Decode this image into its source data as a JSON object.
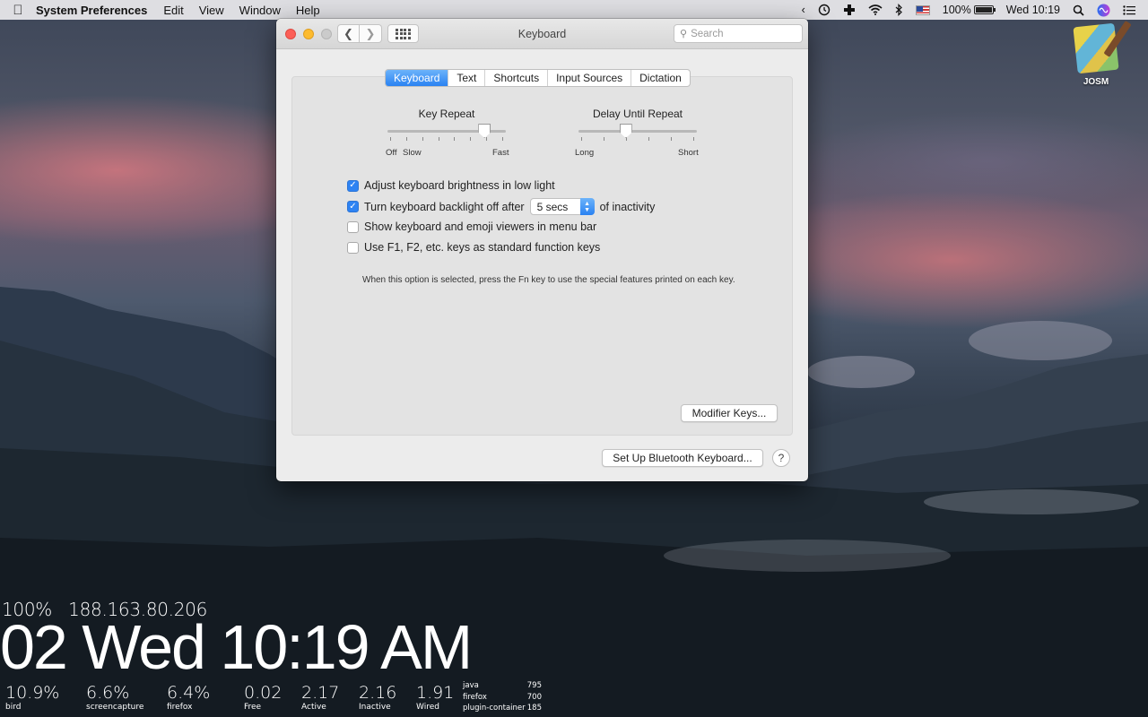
{
  "menubar": {
    "app_name": "System Preferences",
    "menus": [
      "Edit",
      "View",
      "Window",
      "Help"
    ],
    "battery_percent": "100%",
    "battery_level": 1.0,
    "clock": "Wed 10:19",
    "icons": [
      "apple-icon",
      "chevron-left-icon",
      "time-machine-icon",
      "plus-cross-icon",
      "wifi-icon",
      "bluetooth-icon",
      "us-flag-icon",
      "battery-icon",
      "search-icon",
      "siri-icon",
      "notification-center-icon"
    ]
  },
  "desktop": {
    "josm_label": "JOSM"
  },
  "window": {
    "title": "Keyboard",
    "search_placeholder": "Search",
    "tabs": [
      "Keyboard",
      "Text",
      "Shortcuts",
      "Input Sources",
      "Dictation"
    ],
    "active_tab": "Keyboard",
    "key_repeat": {
      "title": "Key Repeat",
      "labels": [
        "Off",
        "Slow",
        "Fast"
      ],
      "level": 0.82
    },
    "delay_until_repeat": {
      "title": "Delay Until Repeat",
      "labels": [
        "Long",
        "Short"
      ],
      "level": 0.4
    },
    "options": [
      {
        "label": "Adjust keyboard brightness in low light",
        "checked": true
      },
      {
        "label": "Turn keyboard backlight off after",
        "checked": true,
        "popup_value": "5 secs",
        "suffix": "of inactivity"
      },
      {
        "label": "Show keyboard and emoji viewers in menu bar",
        "checked": false
      },
      {
        "label": "Use F1, F2, etc. keys as standard function keys",
        "checked": false
      }
    ],
    "fn_hint": "When this option is selected, press the Fn key to use the special features printed on each key.",
    "modifier_keys_button": "Modifier Keys...",
    "bluetooth_button": "Set Up Bluetooth Keyboard...",
    "help_label": "?"
  },
  "widget": {
    "battery": "100%",
    "ip": "188.163.80.206",
    "clock_line": "02 Wed 10:19 AM",
    "cpu": [
      {
        "value": "10.9%",
        "name": "bird"
      },
      {
        "value": "6.6%",
        "name": "screencapture"
      },
      {
        "value": "6.4%",
        "name": "firefox"
      }
    ],
    "memory": [
      {
        "value": "0.02",
        "name": "Free"
      },
      {
        "value": "2.17",
        "name": "Active"
      },
      {
        "value": "2.16",
        "name": "Inactive"
      },
      {
        "value": "1.91",
        "name": "Wired"
      }
    ],
    "processes": [
      {
        "name": "java",
        "value": "795"
      },
      {
        "name": "firefox",
        "value": "700"
      },
      {
        "name": "plugin-container",
        "value": "185"
      }
    ]
  }
}
